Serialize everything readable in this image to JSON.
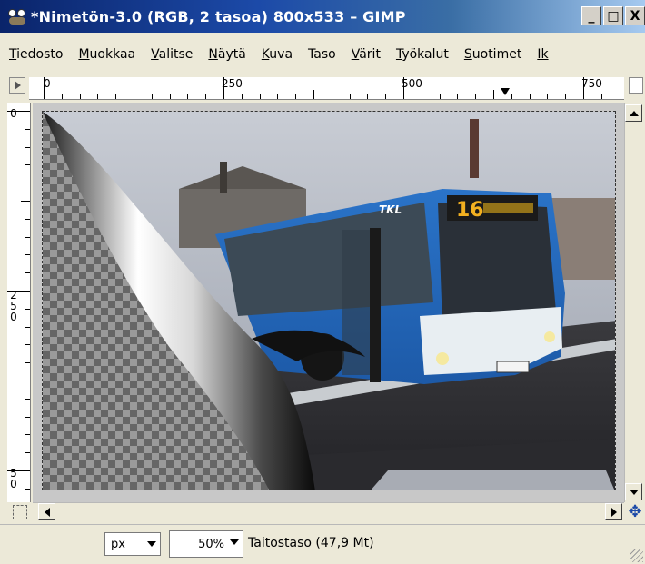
{
  "window": {
    "title": "*Nimetön-3.0 (RGB, 2 tasoa) 800x533 – GIMP",
    "buttons": {
      "minimize": "_",
      "maximize": "□",
      "close": "X"
    }
  },
  "menu": [
    {
      "first": "T",
      "rest": "iedosto"
    },
    {
      "first": "M",
      "rest": "uokkaa"
    },
    {
      "first": "V",
      "rest": "alitse"
    },
    {
      "first": "N",
      "rest": "äytä"
    },
    {
      "first": "K",
      "rest": "uva"
    },
    {
      "first": "Ta",
      "rest": "so"
    },
    {
      "first": "V",
      "rest": "ärit"
    },
    {
      "first": "T",
      "rest": "yökalut"
    },
    {
      "first": "S",
      "rest": "uotimet"
    },
    {
      "first": "Ik",
      "rest": ""
    }
  ],
  "ruler": {
    "h_labels": [
      "0",
      "250",
      "500",
      "750"
    ],
    "v_labels": [
      "0",
      "250",
      "5 0"
    ]
  },
  "statusbar": {
    "unit": "px",
    "zoom": "50%",
    "layer_info": "Taitostaso (47,9 Mt)"
  },
  "icons": {
    "app": "gimp-wilber-icon",
    "nav": "navigate-cross-icon",
    "quickmask": "quick-mask-icon",
    "zoom": "zoom-icon"
  }
}
